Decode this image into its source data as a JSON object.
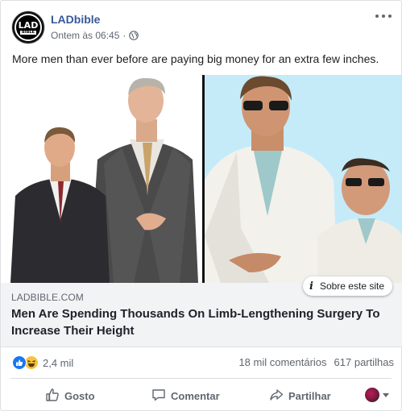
{
  "post": {
    "page_name": "LADbible",
    "avatar_text_top": "LAD",
    "avatar_text_bottom": "BIBLE",
    "timestamp": "Ontem às 06:45",
    "separator": "·",
    "text": "More men than ever before are paying big money for an extra few inches."
  },
  "link": {
    "info_label": "Sobre este site",
    "domain": "LADBIBLE.COM",
    "headline": "Men Are Spending Thousands On Limb-Lengthening Surgery To Increase Their Height"
  },
  "stats": {
    "reactions_count": "2,4 mil",
    "comments": "18 mil comentários",
    "shares": "617 partilhas"
  },
  "actions": {
    "like": "Gosto",
    "comment": "Comentar",
    "share": "Partilhar"
  },
  "icons": {
    "globe": "globe-icon",
    "more": "more-options-icon",
    "like": "thumbs-up-icon",
    "comment": "speech-bubble-icon",
    "share": "share-arrow-icon",
    "info": "info-icon"
  },
  "colors": {
    "link_blue": "#385898",
    "like_blue": "#1877f2",
    "haha_yellow": "#f7c33b",
    "caption_bg": "#f2f3f5",
    "muted_text": "#606770"
  }
}
